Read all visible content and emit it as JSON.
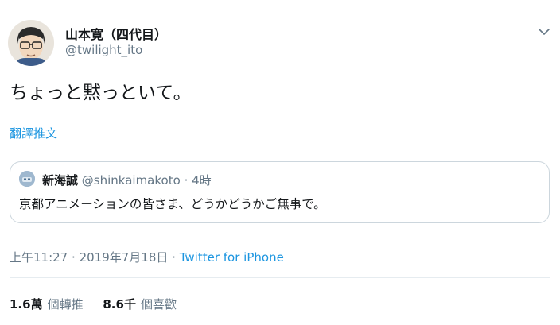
{
  "author": {
    "display_name": "山本寛（四代目）",
    "handle": "@twilight_ito"
  },
  "tweet": {
    "text": "ちょっと黙っといて。",
    "translate_label": "翻譯推文"
  },
  "quote": {
    "display_name": "新海誠",
    "handle": "@shinkaimakoto",
    "separator": "·",
    "time": "4時",
    "text": "京都アニメーションの皆さま、どうかどうかご無事で。"
  },
  "meta": {
    "time": "上午11:27",
    "separator1": "·",
    "date": "2019年7月18日",
    "separator2": "·",
    "source": "Twitter for iPhone"
  },
  "stats": {
    "retweets_count": "1.6萬",
    "retweets_label": "個轉推",
    "likes_count": "8.6千",
    "likes_label": "個喜歡"
  },
  "colors": {
    "link": "#1b95e0",
    "secondary_text": "#657786",
    "border": "#ccd6dd"
  },
  "icons": {
    "menu": "chevron-down-icon"
  }
}
